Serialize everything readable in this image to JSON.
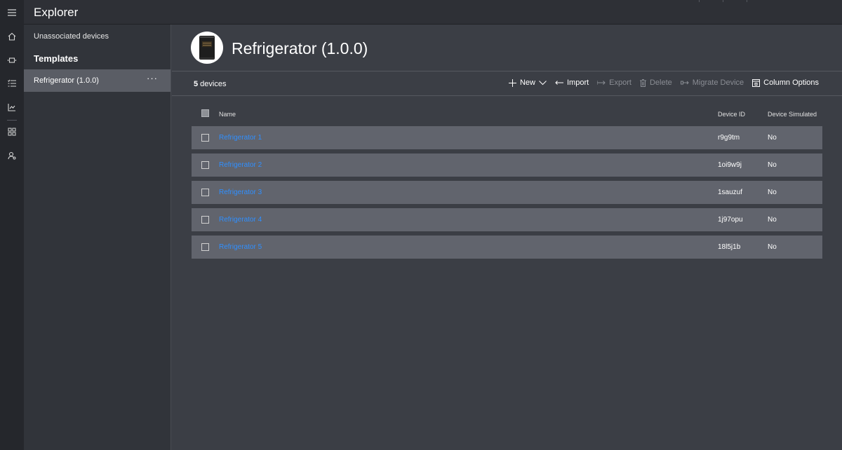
{
  "app": {
    "title": "Explorer"
  },
  "rail": {
    "icons": [
      "hamburger-icon",
      "home-icon",
      "device-icon",
      "rules-icon",
      "analytics-icon",
      "dashboard-icon",
      "admin-icon"
    ]
  },
  "subnav": {
    "unassociated_label": "Unassociated devices",
    "templates_heading": "Templates",
    "items": [
      {
        "label": "Refrigerator (1.0.0)",
        "more": "···"
      }
    ]
  },
  "page": {
    "title": "Refrigerator (1.0.0)",
    "device_count_number": "5",
    "device_count_suffix": " devices"
  },
  "toolbar": {
    "new_label": "New",
    "import_label": "Import",
    "export_label": "Export",
    "delete_label": "Delete",
    "migrate_label": "Migrate Device",
    "column_options_label": "Column Options"
  },
  "table": {
    "headers": {
      "name": "Name",
      "device_id": "Device ID",
      "simulated": "Device Simulated"
    },
    "rows": [
      {
        "name": "Refrigerator 1",
        "device_id": "r9g9tm",
        "simulated": "No"
      },
      {
        "name": "Refrigerator 2",
        "device_id": "1oi9w9j",
        "simulated": "No"
      },
      {
        "name": "Refrigerator 3",
        "device_id": "1sauzuf",
        "simulated": "No"
      },
      {
        "name": "Refrigerator 4",
        "device_id": "1j97opu",
        "simulated": "No"
      },
      {
        "name": "Refrigerator 5",
        "device_id": "18l5j1b",
        "simulated": "No"
      }
    ]
  },
  "colors": {
    "accent_link": "#2f8fff",
    "background": "#3b3e45",
    "rail": "#25272c",
    "row": "#61646d",
    "selected_nav": "#5a5d65"
  }
}
